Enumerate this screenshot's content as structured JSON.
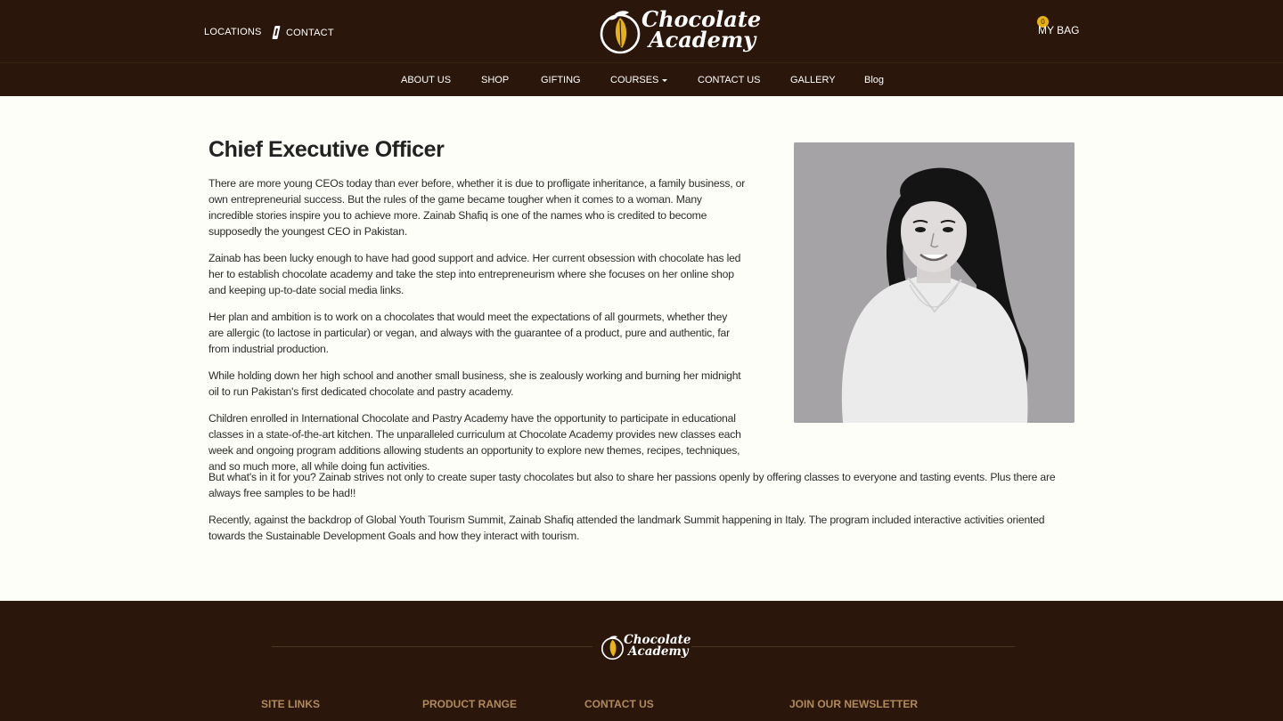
{
  "header": {
    "links": {
      "locations": "LOCATIONS",
      "contact": "CONTACT"
    },
    "logo": {
      "line1": "Chocolate",
      "line2": "Academy"
    },
    "bag": {
      "label": "MY BAG",
      "count": "0"
    }
  },
  "nav": {
    "about": "ABOUT US",
    "shop": "SHOP",
    "gifting": "GIFTING",
    "courses": "COURSES",
    "contact": "CONTACT US",
    "gallery": "GALLERY",
    "blog": "Blog"
  },
  "main": {
    "title": "Chief Executive Officer",
    "paragraphs": [
      "There are more young CEOs today than ever before, whether it is due to profligate inheritance, a family business, or own entrepreneurial success. But the rules of the game became tougher when it comes to a woman. Many incredible stories inspire you to achieve more. Zainab Shafiq is one of the names who is credited to become supposedly the youngest CEO in Pakistan.",
      "Zainab has been lucky enough to have had good support and advice. Her current obsession with chocolate has led her to establish chocolate academy and take the step into entrepreneurism where she focuses on her online shop and keeping up-to-date social media links.",
      "Her plan and ambition is to work on a chocolates that would meet the expectations of all gourmets, whether they are allergic (to lactose in particular) or vegan, and always with the guarantee of a product, pure and authentic, far from industrial production.",
      "While holding down her high school and another small business, she is zealously working and burning her midnight oil to run Pakistan's first dedicated chocolate and pastry academy.",
      "Children enrolled in International Chocolate and Pastry Academy have the opportunity to participate in educational classes in a state-of-the-art kitchen. The unparalleled curriculum at Chocolate Academy provides new classes each week and ongoing program additions allowing students an opportunity to explore new themes, recipes, techniques, and so much more, all while doing fun activities.",
      "But what's in it for you? Zainab strives not only to create super tasty chocolates but also to share her passions openly by offering classes to everyone and tasting events. Plus there are always free samples to be had!!",
      "Recently, against the backdrop of Global Youth Tourism Summit, Zainab Shafiq attended the landmark Summit happening in Italy. The program included interactive activities oriented towards the Sustainable Development Goals and how they interact with tourism."
    ]
  },
  "footer": {
    "logo": {
      "line1": "Chocolate",
      "line2": "Academy"
    },
    "headings": {
      "site_links": "SITE LINKS",
      "product_range": "PRODUCT RANGE",
      "contact_us": "CONTACT US",
      "newsletter": "JOIN OUR NEWSLETTER"
    }
  },
  "colors": {
    "header_bg": "#2a160a",
    "page_bg": "#fefef8",
    "accent_gold": "#e7b313",
    "footer_heading": "#b08a5a"
  },
  "icons": [
    "phone-icon",
    "cocoa-pod-logo-icon",
    "bag-badge"
  ]
}
